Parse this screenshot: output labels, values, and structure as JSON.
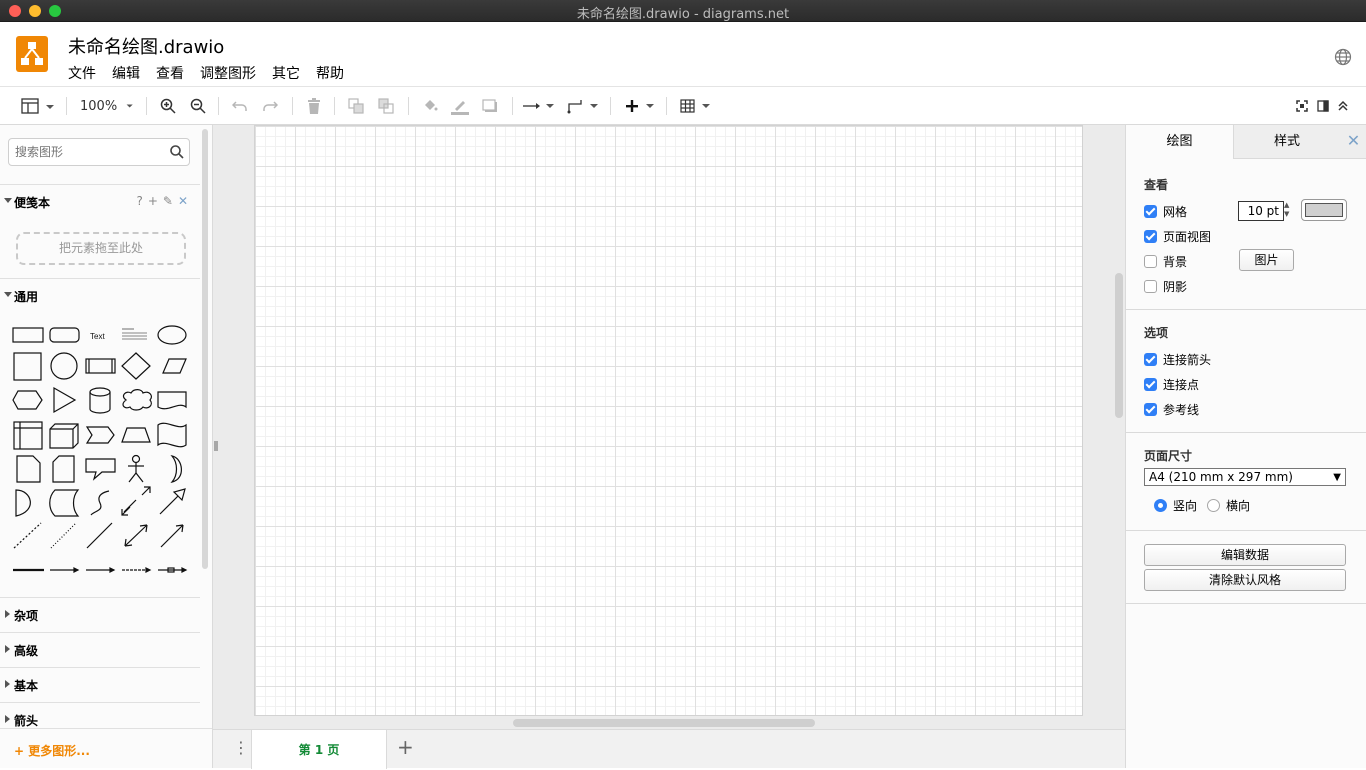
{
  "window": {
    "title": "未命名绘图.drawio - diagrams.net"
  },
  "header": {
    "filename": "未命名绘图.drawio",
    "menus": [
      "文件",
      "编辑",
      "查看",
      "调整图形",
      "其它",
      "帮助"
    ]
  },
  "toolbar": {
    "zoom": "100%"
  },
  "sidebar": {
    "search_placeholder": "搜索图形",
    "scratchpad": {
      "label": "便笺本",
      "dropzone": "把元素拖至此处"
    },
    "general": {
      "label": "通用",
      "text_shape": "Text"
    },
    "collapsed_sections": [
      "杂项",
      "高级",
      "基本",
      "箭头"
    ],
    "more_shapes": "+ 更多图形..."
  },
  "pages": {
    "tab": "第 1 页"
  },
  "panel": {
    "tabs": {
      "diagram": "绘图",
      "style": "样式"
    },
    "view": {
      "title": "查看",
      "grid": {
        "label": "网格",
        "checked": true,
        "size": "10 pt"
      },
      "page_view": {
        "label": "页面视图",
        "checked": true
      },
      "background": {
        "label": "背景",
        "checked": false,
        "image_button": "图片"
      },
      "shadow": {
        "label": "阴影",
        "checked": false
      }
    },
    "options": {
      "title": "选项",
      "connection_arrows": {
        "label": "连接箭头",
        "checked": true
      },
      "connection_points": {
        "label": "连接点",
        "checked": true
      },
      "guides": {
        "label": "参考线",
        "checked": true
      }
    },
    "paper": {
      "title": "页面尺寸",
      "size": "A4 (210 mm x 297 mm)",
      "portrait": "竖向",
      "landscape": "横向",
      "orientation": "portrait"
    },
    "buttons": {
      "edit_data": "编辑数据",
      "clear_default_style": "清除默认风格"
    }
  },
  "colors": {
    "accent": "#f08705",
    "checkbox": "#2f7ff6",
    "page_tab_text": "#138a36"
  }
}
